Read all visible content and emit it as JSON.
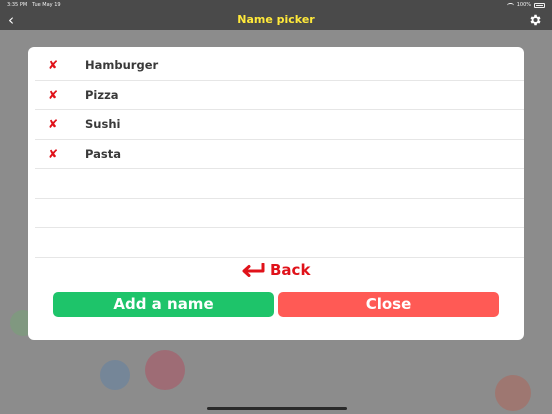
{
  "status_bar": {
    "time": "3:35 PM",
    "date": "Tue May 19",
    "battery": "100%"
  },
  "nav": {
    "title": "Name picker",
    "back_icon": "chevron-left-icon",
    "settings_icon": "gear-icon"
  },
  "names": [
    {
      "label": "Hamburger",
      "delete_glyph": "✘"
    },
    {
      "label": "Pizza",
      "delete_glyph": "✘"
    },
    {
      "label": "Sushi",
      "delete_glyph": "✘"
    },
    {
      "label": "Pasta",
      "delete_glyph": "✘"
    }
  ],
  "empty_rows": 3,
  "back_link": {
    "label": "Back",
    "icon": "return-arrow-icon"
  },
  "buttons": {
    "add_label": "Add a name",
    "close_label": "Close"
  },
  "colors": {
    "nav_title": "#ffe93a",
    "delete": "#e0121a",
    "add_button": "#1ec46a",
    "close_button": "#ff5a55"
  }
}
